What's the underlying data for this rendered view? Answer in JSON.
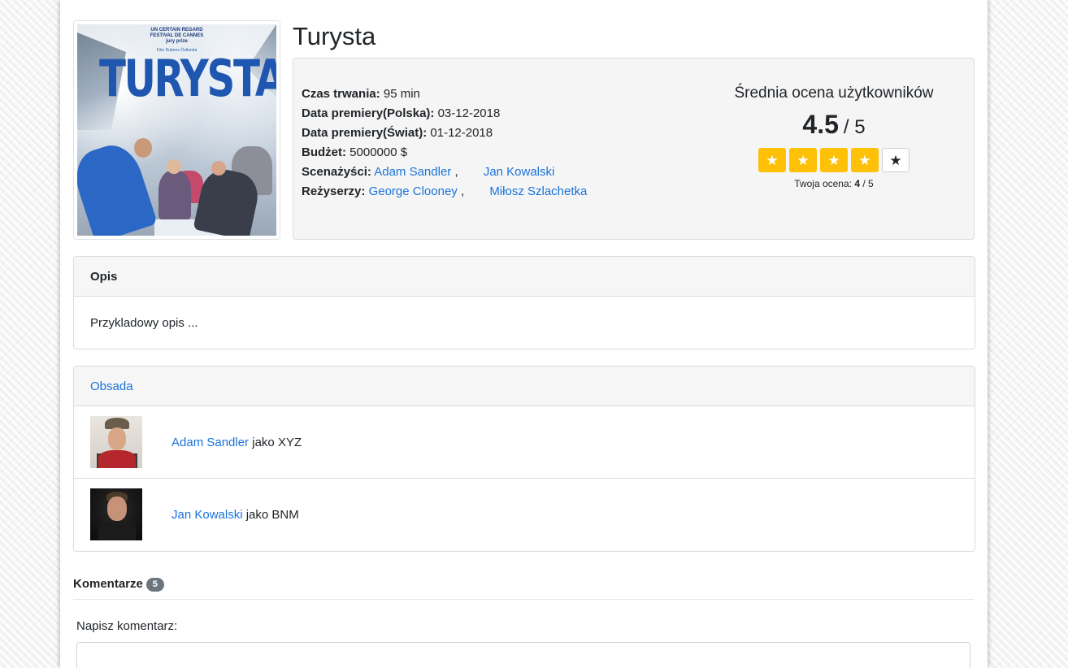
{
  "movie": {
    "title": "Turysta",
    "poster": {
      "festival_line1": "UN CERTAIN REGARD",
      "festival_line2": "FESTIVAL DE CANNES",
      "festival_line3": "jury prize",
      "director_line": "Film Rubens Östlunda",
      "title": "TURYSTA"
    }
  },
  "info": {
    "duration_label": "Czas trwania:",
    "duration_value": "95 min",
    "premiere_pl_label": "Data premiery(Polska):",
    "premiere_pl_value": "03-12-2018",
    "premiere_world_label": "Data premiery(Świat):",
    "premiere_world_value": "01-12-2018",
    "budget_label": "Budżet:",
    "budget_value": "5000000 $",
    "writers_label": "Scenażyści:",
    "writers": [
      "Adam Sandler",
      "Jan Kowalski"
    ],
    "directors_label": "Reżyserzy:",
    "directors": [
      "George Clooney",
      "Miłosz Szlachetka"
    ],
    "separator": ","
  },
  "rating": {
    "heading": "Średnia ocena użytkowników",
    "average": "4.5",
    "max": "/ 5",
    "stars_filled": 4,
    "stars_total": 5,
    "star_icon": "★",
    "your_rating_label": "Twoja ocena:",
    "your_rating_value": "4",
    "your_rating_max": "/ 5",
    "star_color": "#ffc107"
  },
  "description": {
    "header": "Opis",
    "text": "Przykladowy opis ..."
  },
  "cast": {
    "header": "Obsada",
    "connector": "jako",
    "members": [
      {
        "name": "Adam Sandler",
        "role": "XYZ"
      },
      {
        "name": "Jan Kowalski",
        "role": "BNM"
      }
    ]
  },
  "comments": {
    "heading": "Komentarze",
    "count": "5",
    "write_label": "Napisz komentarz:",
    "input_value": ""
  },
  "colors": {
    "link": "#1a73d9",
    "badge": "#6c757d"
  }
}
